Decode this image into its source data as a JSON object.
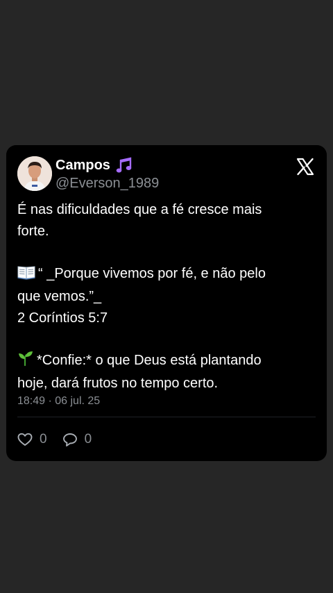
{
  "tweet": {
    "display_name": "Campos",
    "handle": "@Everson_1989",
    "lines": [
      "É nas dificuldades que a fé cresce mais",
      "forte.",
      "",
      "“ _Porque vivemos por fé, e não pelo",
      "que vemos.”_",
      "2 Coríntios 5:7",
      "",
      "*Confie:* o que Deus está plantando",
      "hoje, dará frutos no tempo certo."
    ],
    "timestamp": "18:49 · 06 jul. 25",
    "likes_count": "0",
    "replies_count": "0"
  },
  "icons": {
    "name_badge": "musical-notes-icon",
    "brand": "x-logo-icon",
    "book": "open-book-emoji",
    "sprout": "seedling-emoji",
    "like": "heart-icon",
    "reply": "comment-icon"
  },
  "colors": {
    "page_background": "#262626",
    "card_background": "#000000",
    "primary_text": "#ffffff",
    "secondary_text": "#8b8f94",
    "music_badge": "#a66cff"
  }
}
